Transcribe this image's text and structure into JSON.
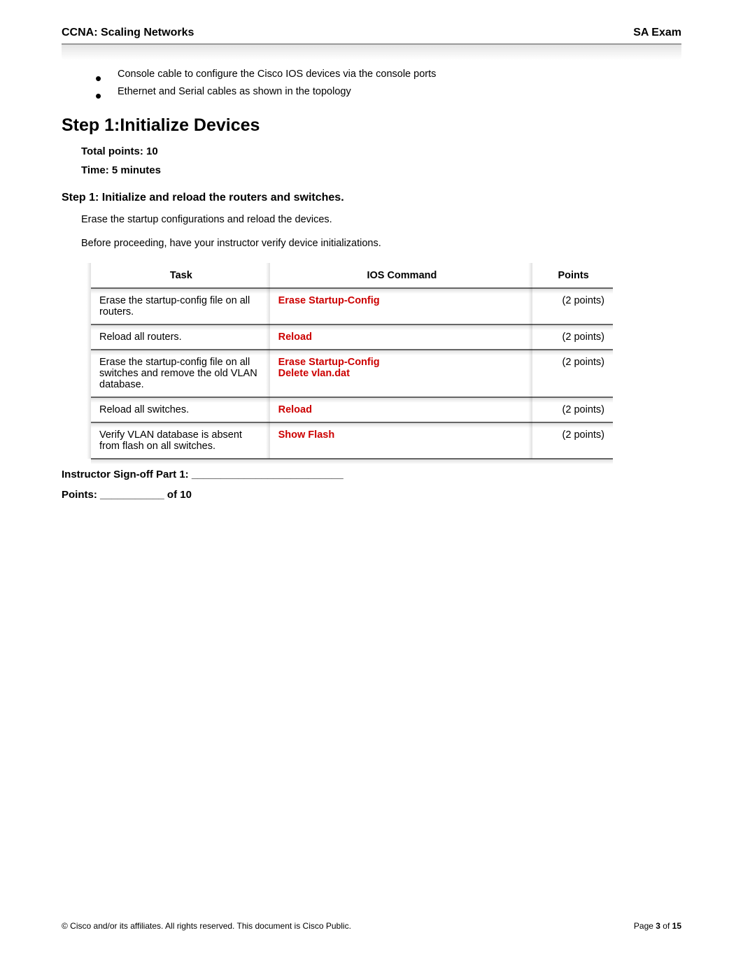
{
  "header": {
    "left": "CCNA: Scaling Networks",
    "right": "SA Exam"
  },
  "bullets": {
    "b1": "Console cable to configure the Cisco IOS devices via the console ports",
    "b2": "Ethernet and Serial cables as shown in the topology"
  },
  "step_title": "Step 1:Initialize Devices",
  "total_points": "Total points: 10",
  "time": "Time: 5 minutes",
  "step_label": "Step 1:   Initialize and reload the routers and switches.",
  "body1": "Erase the startup configurations and reload the devices.",
  "body2": "Before proceeding, have your instructor verify device initializations.",
  "table": {
    "head": {
      "task": "Task",
      "cmd": "IOS Command",
      "pts": "Points"
    },
    "rows": [
      {
        "task": "Erase the startup-config file on all routers.",
        "cmd": "Erase Startup-Config",
        "pts": "(2 points)"
      },
      {
        "task": "Reload all routers.",
        "cmd": "Reload",
        "pts": "(2 points)"
      },
      {
        "task": "Erase the startup-config file on all switches and remove the old VLAN database.",
        "cmd": "Erase Startup-Config",
        "cmd2": "Delete vlan.dat",
        "pts": "(2 points)"
      },
      {
        "task": "Reload all switches.",
        "cmd": "Reload",
        "pts": "(2 points)"
      },
      {
        "task": "Verify VLAN database is absent from flash on all switches.",
        "cmd": "Show Flash",
        "pts": "(2 points)"
      }
    ]
  },
  "signoff": "Instructor Sign-off Part 1: __________________________",
  "points_line": "Points: ___________ of 10",
  "footer": {
    "left": "© Cisco and/or its affiliates. All rights reserved. This document is Cisco Public.",
    "page_prefix": "Page ",
    "page_num": "3",
    "page_mid": " of ",
    "page_total": "15"
  },
  "chart_data": {
    "type": "table",
    "title": "Step 1: Initialize Devices — IOS Command points table",
    "columns": [
      "Task",
      "IOS Command",
      "Points"
    ],
    "rows": [
      [
        "Erase the startup-config file on all routers.",
        "Erase Startup-Config",
        2
      ],
      [
        "Reload all routers.",
        "Reload",
        2
      ],
      [
        "Erase the startup-config file on all switches and remove the old VLAN database.",
        "Erase Startup-Config; Delete vlan.dat",
        2
      ],
      [
        "Reload all switches.",
        "Reload",
        2
      ],
      [
        "Verify VLAN database is absent from flash on all switches.",
        "Show Flash",
        2
      ]
    ],
    "total_points": 10
  }
}
